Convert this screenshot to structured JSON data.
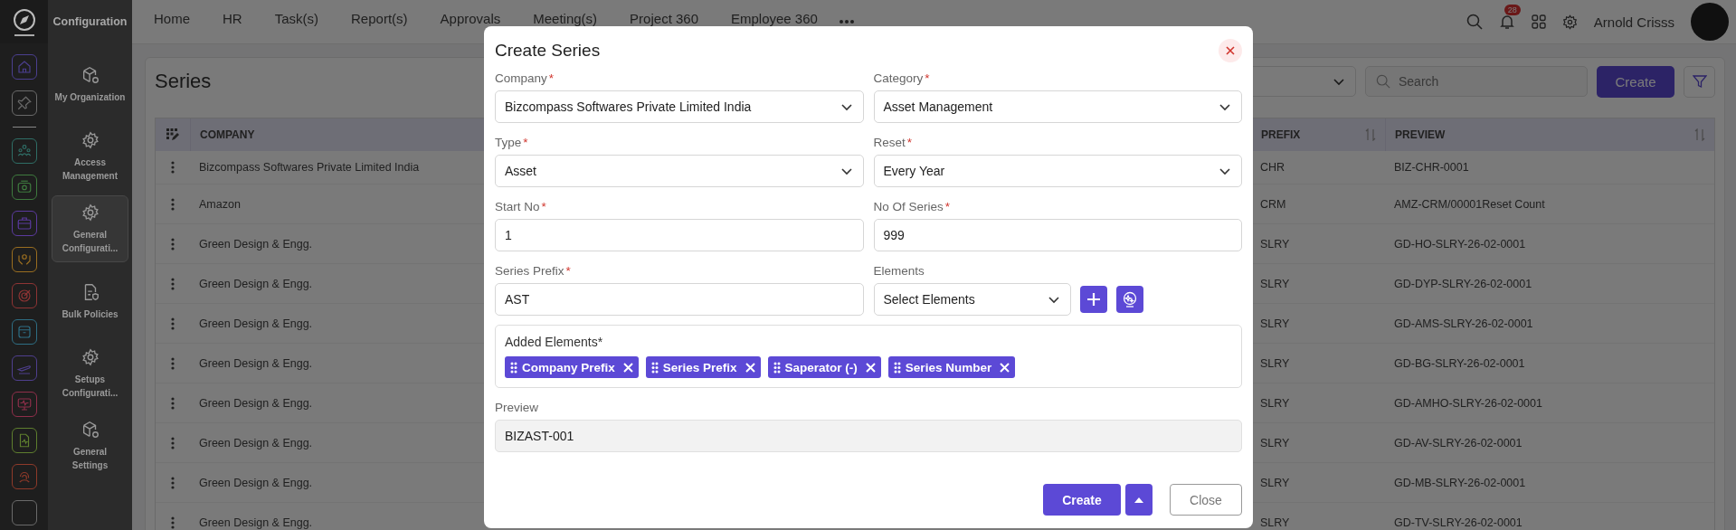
{
  "rail": {
    "items": [
      {
        "kind": "home",
        "color": "#4b3f8f"
      },
      {
        "kind": "pin",
        "color": "#6a6a6a"
      },
      {
        "kind": "people",
        "color": "#2f6e66"
      },
      {
        "kind": "money",
        "color": "#3e7a3e"
      },
      {
        "kind": "briefcase",
        "color": "#5b3a9e"
      },
      {
        "kind": "hands",
        "color": "#9a6e20"
      },
      {
        "kind": "target",
        "color": "#8e3434"
      },
      {
        "kind": "archive",
        "color": "#2e6e84"
      },
      {
        "kind": "plane",
        "color": "#4f3f8e"
      },
      {
        "kind": "monitor",
        "color": "#8e2f4a"
      },
      {
        "kind": "document",
        "color": "#5e7e2e"
      },
      {
        "kind": "fingerprint",
        "color": "#8e3a2a"
      },
      {
        "kind": "blank",
        "color": "#6a6a6a"
      }
    ]
  },
  "config_panel": {
    "title": "Configuration",
    "items": [
      {
        "kind": "box-gear",
        "label": "My Organization",
        "selected": false
      },
      {
        "kind": "gear",
        "label": "Access Management",
        "selected": false
      },
      {
        "kind": "gear",
        "label": "General Configurati...",
        "selected": true
      },
      {
        "kind": "doc-shield",
        "label": "Bulk Policies",
        "selected": false
      },
      {
        "kind": "gear",
        "label": "Setups Configurati...",
        "selected": false
      },
      {
        "kind": "box-gear",
        "label": "General Settings",
        "selected": false
      }
    ]
  },
  "top_nav": {
    "items": [
      "Home",
      "HR",
      "Task(s)",
      "Report(s)",
      "Approvals",
      "Meeting(s)",
      "Project 360",
      "Employee 360"
    ]
  },
  "header_right": {
    "notification_count": "28",
    "user_name": "Arnold Crisss"
  },
  "page": {
    "title": "Series",
    "search": {
      "placeholder": "Search"
    },
    "create_button": "Create"
  },
  "table": {
    "company_column": {
      "label": "COMPANY"
    },
    "sortable_columns": [
      {
        "label": "PREFIX"
      },
      {
        "label": "PREVIEW"
      }
    ],
    "rows": [
      {
        "company": "Bizcompass Softwares Private Limited India",
        "prefix": "CHR",
        "preview": "BIZ-CHR-0001"
      },
      {
        "company": "Amazon",
        "prefix": "CRM",
        "preview": "AMZ-CRM/00001Reset Count"
      },
      {
        "company": "Green Design & Engg.",
        "prefix": "SLRY",
        "preview": "GD-HO-SLRY-26-02-0001"
      },
      {
        "company": "Green Design & Engg.",
        "prefix": "SLRY",
        "preview": "GD-DYP-SLRY-26-02-0001"
      },
      {
        "company": "Green Design & Engg.",
        "prefix": "SLRY",
        "preview": "GD-AMS-SLRY-26-02-0001"
      },
      {
        "company": "Green Design & Engg.",
        "prefix": "SLRY",
        "preview": "GD-BG-SLRY-26-02-0001"
      },
      {
        "company": "Green Design & Engg.",
        "prefix": "SLRY",
        "preview": "GD-AMHO-SLRY-26-02-0001"
      },
      {
        "company": "Green Design & Engg.",
        "prefix": "SLRY",
        "preview": "GD-AV-SLRY-26-02-0001"
      },
      {
        "company": "Green Design & Engg.",
        "prefix": "SLRY",
        "preview": "GD-MB-SLRY-26-02-0001"
      },
      {
        "company": "Green Design & Engg.",
        "prefix": "SLRY",
        "preview": "GD-TV-SLRY-26-02-0001"
      }
    ]
  },
  "dialog": {
    "title": "Create Series",
    "fields": [
      {
        "kind": "select",
        "label": "Company",
        "required_mark": "*",
        "value": "Bizcompass Softwares Private Limited India"
      },
      {
        "kind": "select",
        "label": "Category",
        "required_mark": "*",
        "value": "Asset Management"
      },
      {
        "kind": "select",
        "label": "Type",
        "required_mark": "*",
        "value": "Asset"
      },
      {
        "kind": "select",
        "label": "Reset",
        "required_mark": "*",
        "value": "Every Year"
      },
      {
        "kind": "input",
        "label": "Start No",
        "required_mark": "*",
        "value": "1"
      },
      {
        "kind": "input",
        "label": "No Of Series",
        "required_mark": "*",
        "value": "999"
      },
      {
        "kind": "input",
        "label": "Series Prefix",
        "required_mark": "*",
        "value": "AST"
      },
      {
        "kind": "picker",
        "label": "Elements",
        "value": "Select Elements"
      }
    ],
    "added_elements": {
      "label": "Added Elements*",
      "chips": [
        "Company Prefix",
        "Series Prefix",
        "Saperator (-)",
        "Series Number"
      ]
    },
    "preview": {
      "label": "Preview",
      "value": "BIZAST-001"
    },
    "buttons": {
      "create": "Create",
      "close": "Close"
    }
  }
}
